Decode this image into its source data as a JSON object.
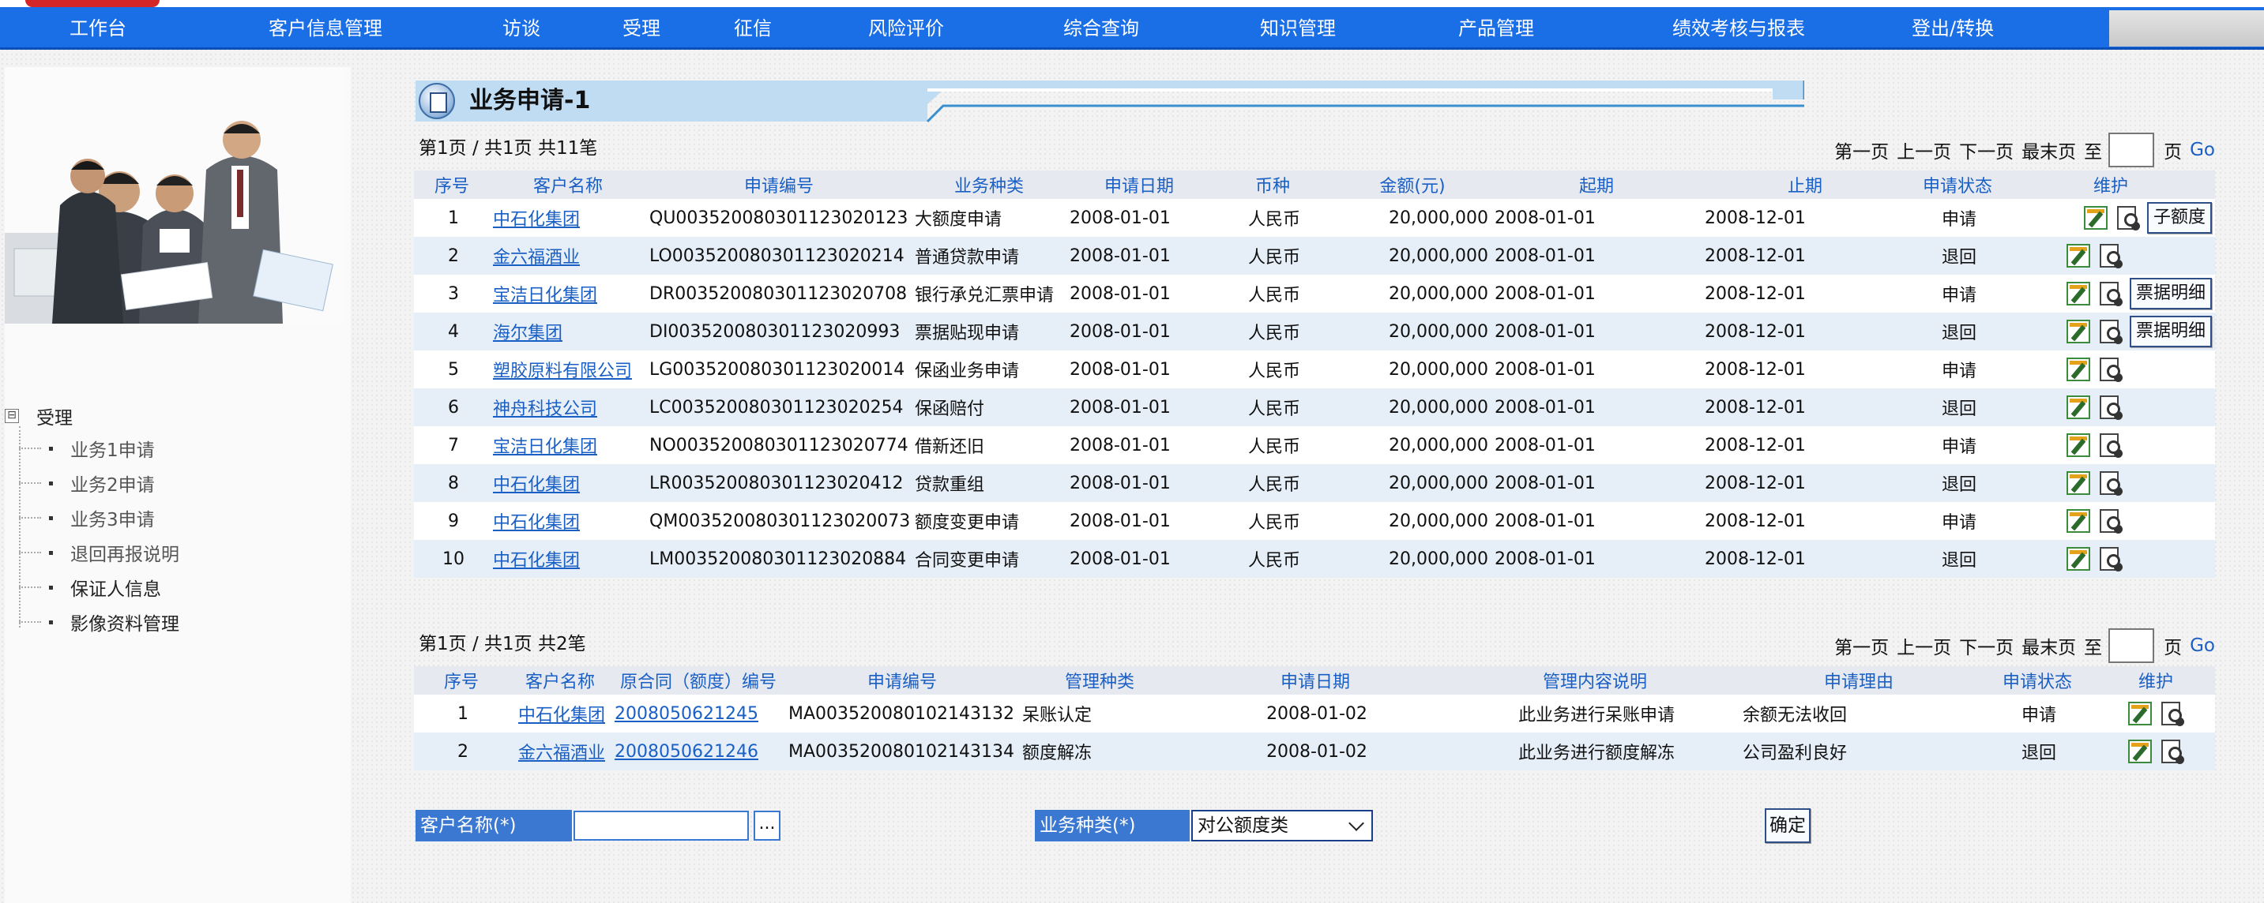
{
  "nav": {
    "items": [
      "工作台",
      "客户信息管理",
      "访谈",
      "受理",
      "征信",
      "风险评价",
      "综合查询",
      "知识管理",
      "产品管理",
      "绩效考核与报表",
      "登出/转换"
    ]
  },
  "sidebar": {
    "root_label": "受理",
    "expand_symbol": "⊟",
    "items": [
      "业务1申请",
      "业务2申请",
      "业务3申请",
      "退回再报说明",
      "保证人信息",
      "影像资料管理"
    ]
  },
  "page": {
    "title": "业务申请-1"
  },
  "pager1": {
    "info": "第1页 / 共1页  共11笔",
    "first": "第一页",
    "prev": "上一页",
    "next": "下一页",
    "last": "最末页",
    "to": "至",
    "page_unit": "页",
    "go": "Go"
  },
  "table1": {
    "headers": [
      "序号",
      "客户名称",
      "申请编号",
      "业务种类",
      "申请日期",
      "币种",
      "金额(元)",
      "起期",
      "止期",
      "申请状态",
      "维护"
    ],
    "rows": [
      {
        "no": "1",
        "customer": "中石化集团",
        "app_no": "QU003520080301123020123",
        "type": "大额度申请",
        "date": "2008-01-01",
        "currency": "人民币",
        "amount": "20,000,000",
        "start": "2008-01-01",
        "end": "2008-12-01",
        "status": "申请",
        "extra": "子额度"
      },
      {
        "no": "2",
        "customer": "金六福酒业",
        "app_no": "LO003520080301123020214",
        "type": "普通贷款申请",
        "date": "2008-01-01",
        "currency": "人民币",
        "amount": "20,000,000",
        "start": "2008-01-01",
        "end": "2008-12-01",
        "status": "退回",
        "extra": ""
      },
      {
        "no": "3",
        "customer": "宝洁日化集团",
        "app_no": "DR003520080301123020708",
        "type": "银行承兑汇票申请",
        "date": "2008-01-01",
        "currency": "人民币",
        "amount": "20,000,000",
        "start": "2008-01-01",
        "end": "2008-12-01",
        "status": "申请",
        "extra": "票据明细"
      },
      {
        "no": "4",
        "customer": "海尔集团",
        "app_no": "DI003520080301123020993",
        "type": "票据贴现申请",
        "date": "2008-01-01",
        "currency": "人民币",
        "amount": "20,000,000",
        "start": "2008-01-01",
        "end": "2008-12-01",
        "status": "退回",
        "extra": "票据明细"
      },
      {
        "no": "5",
        "customer": "塑胶原料有限公司",
        "app_no": "LG003520080301123020014",
        "type": "保函业务申请",
        "date": "2008-01-01",
        "currency": "人民币",
        "amount": "20,000,000",
        "start": "2008-01-01",
        "end": "2008-12-01",
        "status": "申请",
        "extra": ""
      },
      {
        "no": "6",
        "customer": "神舟科技公司",
        "app_no": "LC003520080301123020254",
        "type": "保函赔付",
        "date": "2008-01-01",
        "currency": "人民币",
        "amount": "20,000,000",
        "start": "2008-01-01",
        "end": "2008-12-01",
        "status": "退回",
        "extra": ""
      },
      {
        "no": "7",
        "customer": "宝洁日化集团",
        "app_no": "NO003520080301123020774",
        "type": "借新还旧",
        "date": "2008-01-01",
        "currency": "人民币",
        "amount": "20,000,000",
        "start": "2008-01-01",
        "end": "2008-12-01",
        "status": "申请",
        "extra": ""
      },
      {
        "no": "8",
        "customer": "中石化集团",
        "app_no": "LR003520080301123020412",
        "type": "贷款重组",
        "date": "2008-01-01",
        "currency": "人民币",
        "amount": "20,000,000",
        "start": "2008-01-01",
        "end": "2008-12-01",
        "status": "退回",
        "extra": ""
      },
      {
        "no": "9",
        "customer": "中石化集团",
        "app_no": "QM003520080301123020073",
        "type": "额度变更申请",
        "date": "2008-01-01",
        "currency": "人民币",
        "amount": "20,000,000",
        "start": "2008-01-01",
        "end": "2008-12-01",
        "status": "申请",
        "extra": ""
      },
      {
        "no": "10",
        "customer": "中石化集团",
        "app_no": "LM003520080301123020884",
        "type": "合同变更申请",
        "date": "2008-01-01",
        "currency": "人民币",
        "amount": "20,000,000",
        "start": "2008-01-01",
        "end": "2008-12-01",
        "status": "退回",
        "extra": ""
      }
    ]
  },
  "pager2": {
    "info": "第1页 / 共1页  共2笔",
    "first": "第一页",
    "prev": "上一页",
    "next": "下一页",
    "last": "最末页",
    "to": "至",
    "page_unit": "页",
    "go": "Go"
  },
  "table2": {
    "headers": [
      "序号",
      "客户名称",
      "原合同（额度）编号",
      "申请编号",
      "管理种类",
      "申请日期",
      "管理内容说明",
      "申请理由",
      "申请状态",
      "维护"
    ],
    "rows": [
      {
        "no": "1",
        "customer": "中石化集团",
        "contract": "2008050621245",
        "app_no": "MA003520080102143132",
        "kind": "呆账认定",
        "date": "2008-01-02",
        "desc": "此业务进行呆账申请",
        "reason": "余额无法收回",
        "status": "申请"
      },
      {
        "no": "2",
        "customer": "金六福酒业",
        "contract": "2008050621246",
        "app_no": "MA003520080102143134",
        "kind": "额度解冻",
        "date": "2008-01-02",
        "desc": "此业务进行额度解冻",
        "reason": "公司盈利良好",
        "status": "退回"
      }
    ]
  },
  "form": {
    "customer_label": "客户名称(*)",
    "customer_value": "",
    "browse_label": "...",
    "type_label": "业务种类(*)",
    "type_selected": "对公额度类",
    "confirm": "确定"
  },
  "colors": {
    "nav_bg": "#1a6ee6",
    "link": "#1a5fc4",
    "header_bg": "#e6eaf0",
    "row_alt": "#e6eff8",
    "label_bg": "#3b78d2"
  },
  "icons": [
    "edit-icon",
    "view-icon",
    "document-icon",
    "expand-icon",
    "chevron-down-icon"
  ]
}
